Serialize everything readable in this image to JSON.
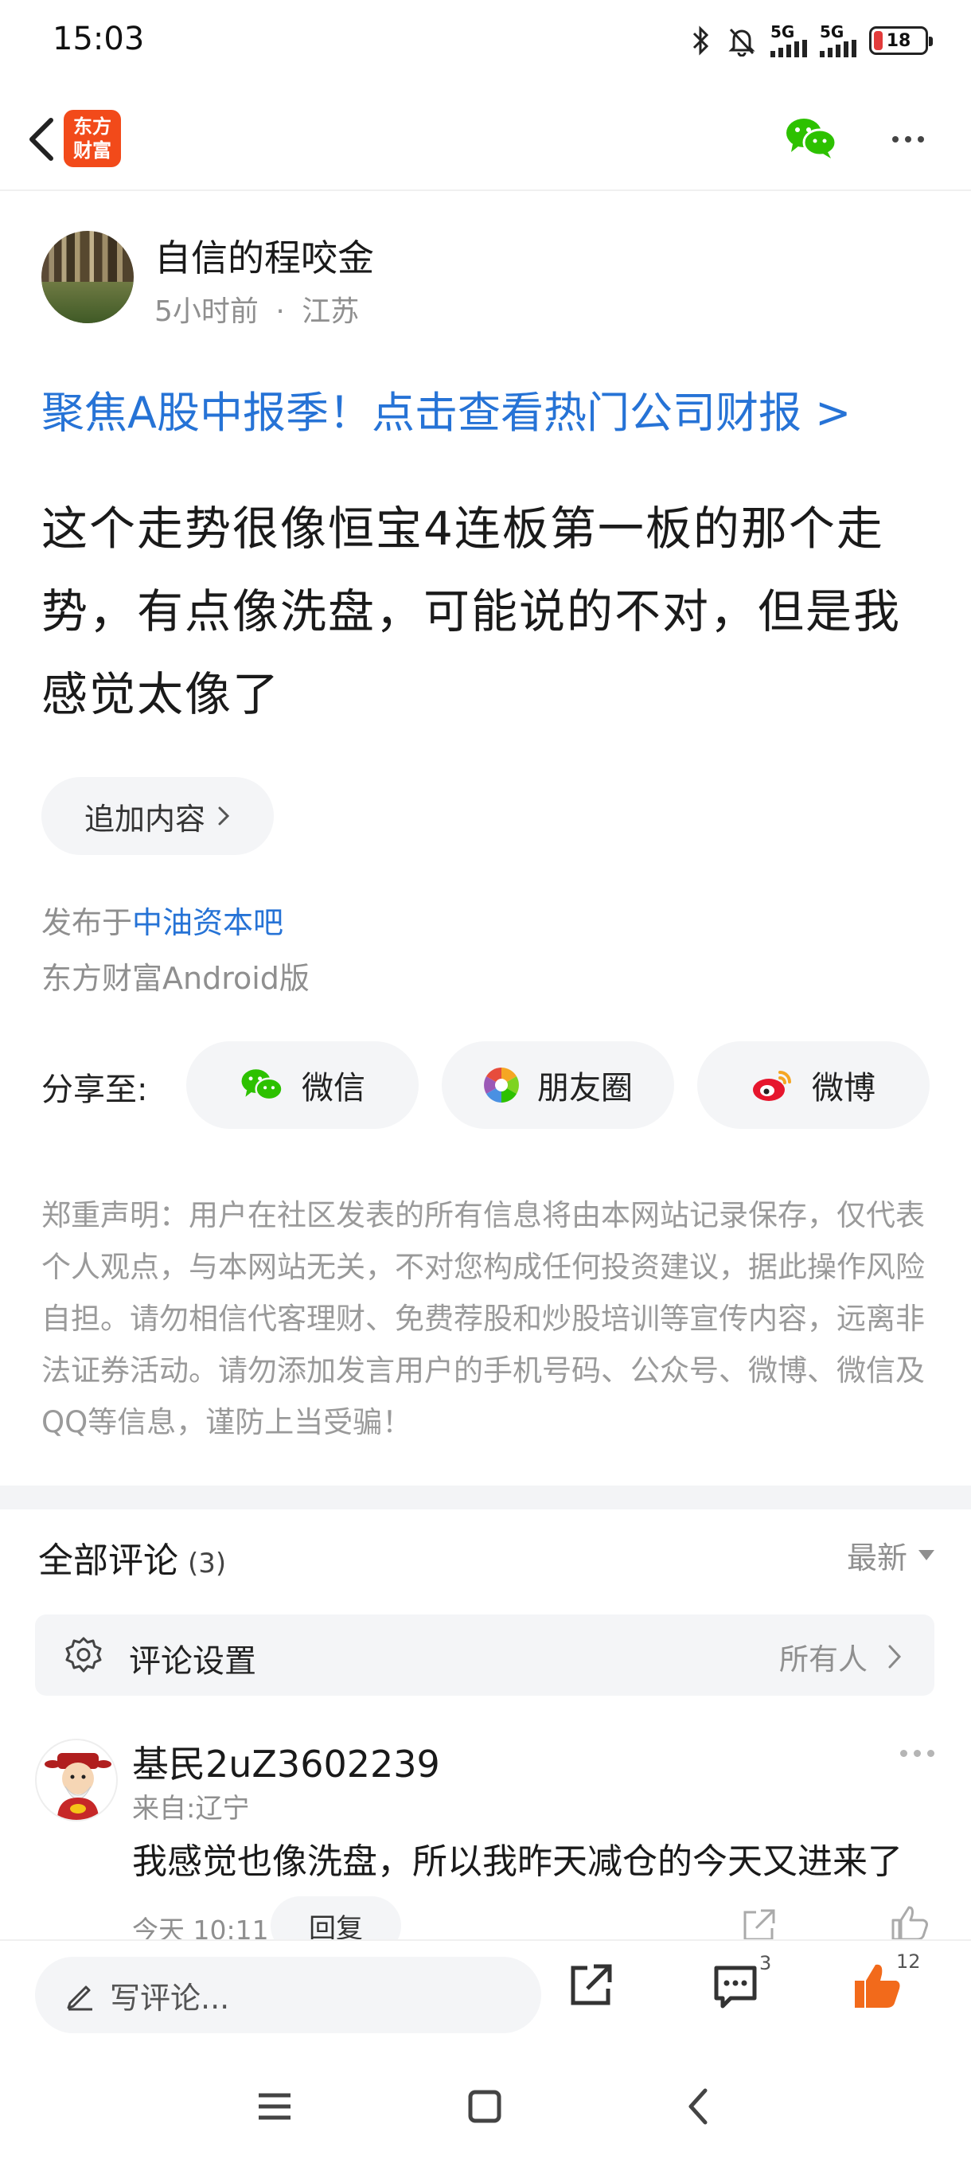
{
  "status_bar": {
    "time": "15:03",
    "network_1": "5G",
    "network_2": "5G",
    "battery": "18",
    "battery_level": 0.18
  },
  "header": {
    "logo_line1": "东方",
    "logo_line2": "财富",
    "logo_color": "#f24a1a"
  },
  "post": {
    "author": "自信的程咬金",
    "time": "5小时前",
    "separator": "·",
    "location": "江苏",
    "promo": "聚焦A股中报季！点击查看热门公司财报 >",
    "body": "这个走势很像恒宝4连板第一板的那个走势，有点像洗盘，可能说的不对，但是我感觉太像了",
    "append_label": "追加内容",
    "published_prefix": "发布于",
    "bar_name": "中油资本吧",
    "client": "东方财富Android版"
  },
  "share": {
    "label": "分享至:",
    "wechat": "微信",
    "moments": "朋友圈",
    "weibo": "微博"
  },
  "disclaimer": "郑重声明：用户在社区发表的所有信息将由本网站记录保存，仅代表个人观点，与本网站无关，不对您构成任何投资建议，据此操作风险自担。请勿相信代客理财、免费荐股和炒股培训等宣传内容，远离非法证券活动。请勿添加发言用户的手机号码、公众号、微博、微信及QQ等信息，谨防上当受骗！",
  "comments": {
    "title": "全部评论",
    "count": "(3)",
    "sort": "最新",
    "settings_label": "评论设置",
    "settings_value": "所有人",
    "items": [
      {
        "user": "基民2uZ3602239",
        "location": "来自:辽宁",
        "text": "我感觉也像洗盘，所以我昨天减仓的今天又进来了",
        "time": "今天 10:11",
        "reply_label": "回复"
      }
    ]
  },
  "bottom_bar": {
    "input_placeholder": "写评论...",
    "comment_count": "3",
    "like_count": "12",
    "accent": "#f26a1b"
  },
  "colors": {
    "link_blue": "#2673d6",
    "wechat_green": "#2dc100",
    "muted": "#8f8f8f"
  }
}
